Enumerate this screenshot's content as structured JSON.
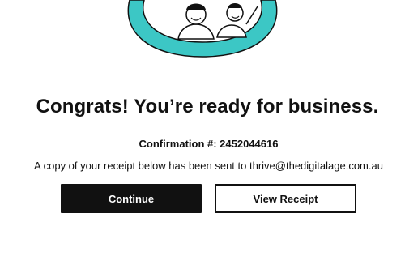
{
  "hero": {
    "illustration": "people-celebrating-illustration",
    "accent_color": "#3cc7c5"
  },
  "main": {
    "title": "Congrats! You’re ready for business.",
    "confirmation_label": "Confirmation #: 2452044616",
    "receipt_note": "A copy of your receipt below has been sent to thrive@thedigitalage.com.au"
  },
  "actions": {
    "continue_label": "Continue",
    "view_receipt_label": "View Receipt"
  }
}
